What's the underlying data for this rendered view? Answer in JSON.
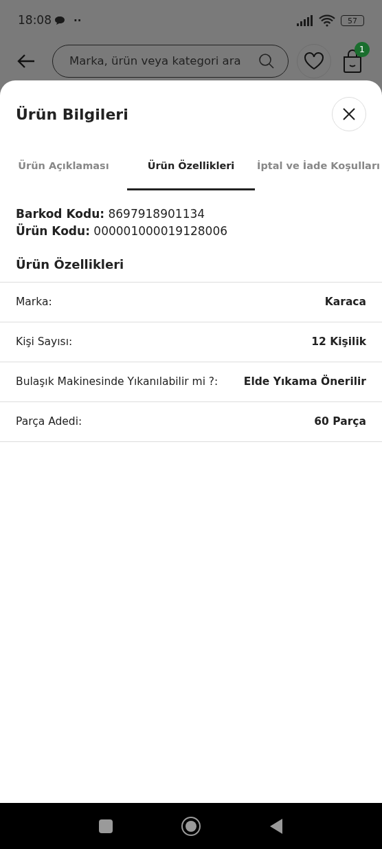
{
  "status_bar": {
    "time": "18:08",
    "dots": "··",
    "battery": "57"
  },
  "header": {
    "search": {
      "placeholder": "Marka, ürün veya kategori ara"
    },
    "cart_badge": "1"
  },
  "sheet": {
    "title": "Ürün Bilgileri",
    "tabs": [
      {
        "label": "Ürün Açıklaması",
        "selected": false
      },
      {
        "label": "Ürün Özellikleri",
        "selected": true
      },
      {
        "label": "İptal ve İade Koşulları",
        "selected": false
      }
    ],
    "codes": [
      "**Barkod Kodu:** 8697918901134",
      "**Ürün Kodu:** 000001000019128006"
    ],
    "section_title": "Ürün Özellikleri",
    "attributes": [
      {
        "name": "Marka:",
        "value": "Karaca"
      },
      {
        "name": "Kişi Sayısı:",
        "value": "12 Kişilik"
      },
      {
        "name": "Bulaşık Makinesinde Yıkanılabilir mi ?:",
        "value": "Elde Yıkama Önerilir"
      },
      {
        "name": "Parça Adedi:",
        "value": "60 Parça"
      }
    ]
  }
}
